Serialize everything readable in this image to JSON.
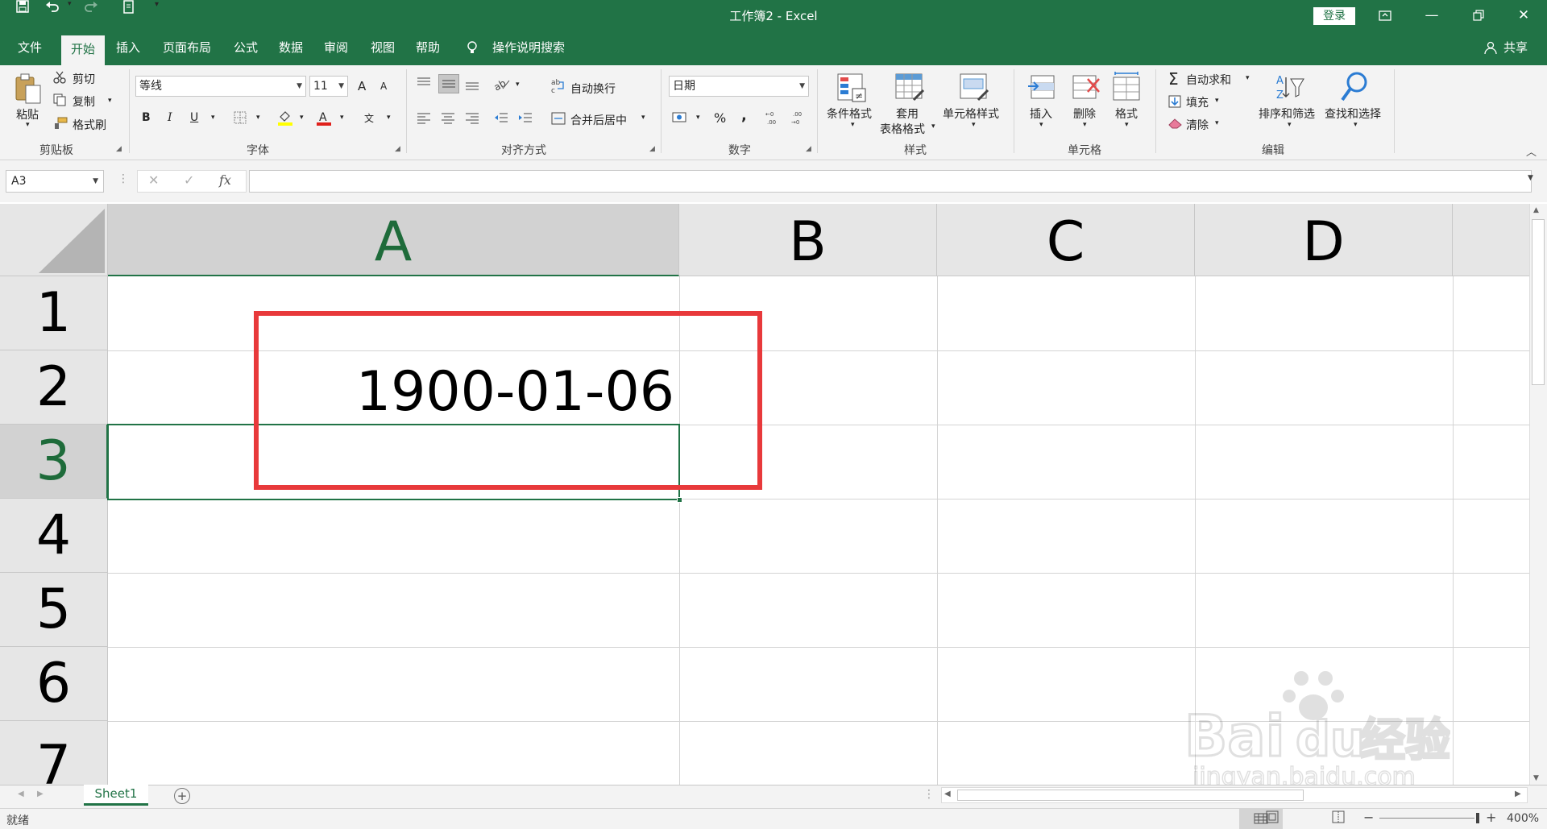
{
  "window": {
    "title": "工作簿2  -  Excel",
    "login_label": "登录"
  },
  "tabs": [
    {
      "label": "文件"
    },
    {
      "label": "开始"
    },
    {
      "label": "插入"
    },
    {
      "label": "页面布局"
    },
    {
      "label": "公式"
    },
    {
      "label": "数据"
    },
    {
      "label": "审阅"
    },
    {
      "label": "视图"
    },
    {
      "label": "帮助"
    },
    {
      "label": "操作说明搜索"
    }
  ],
  "share_label": "共享",
  "ribbon": {
    "clipboard": {
      "paste": "粘贴",
      "cut": "剪切",
      "copy": "复制",
      "format_painter": "格式刷",
      "group": "剪贴板"
    },
    "font": {
      "name": "等线",
      "size": "11",
      "grow": "A",
      "shrink": "A",
      "bold": "B",
      "italic": "I",
      "underline": "U",
      "phonetic": "文",
      "group": "字体"
    },
    "alignment": {
      "wrap": "自动换行",
      "merge": "合并后居中",
      "group": "对齐方式"
    },
    "number": {
      "format": "日期",
      "percent": "%",
      "comma": ",",
      "inc_decimal": ".00",
      "group": "数字"
    },
    "styles": {
      "conditional": "条件格式",
      "table_1": "套用",
      "table_2": "表格格式",
      "cell_styles": "单元格样式",
      "group": "样式"
    },
    "cells": {
      "insert": "插入",
      "delete": "删除",
      "format": "格式",
      "group": "单元格"
    },
    "editing": {
      "autosum": "自动求和",
      "fill": "填充",
      "clear": "清除",
      "sort": "排序和筛选",
      "find": "查找和选择",
      "group": "编辑"
    }
  },
  "formula_bar": {
    "name_box": "A3",
    "fx": "fx",
    "cancel": "✕",
    "enter": "✓",
    "value": ""
  },
  "sheet": {
    "columns": [
      "A",
      "B",
      "C",
      "D"
    ],
    "rows": [
      "1",
      "2",
      "3",
      "4",
      "5",
      "6",
      "7"
    ],
    "cell_A2": "1900-01-06",
    "selected_cell": "A3"
  },
  "sheet_tabs": [
    {
      "label": "Sheet1"
    }
  ],
  "status": {
    "ready": "就绪",
    "zoom": "400%"
  },
  "watermark": {
    "brand": "Bai",
    "brand2": "du",
    "cn": "经验",
    "url": "jingyan.baidu.com"
  },
  "colors": {
    "excel_green": "#217346",
    "highlight_red": "#e8393b"
  }
}
